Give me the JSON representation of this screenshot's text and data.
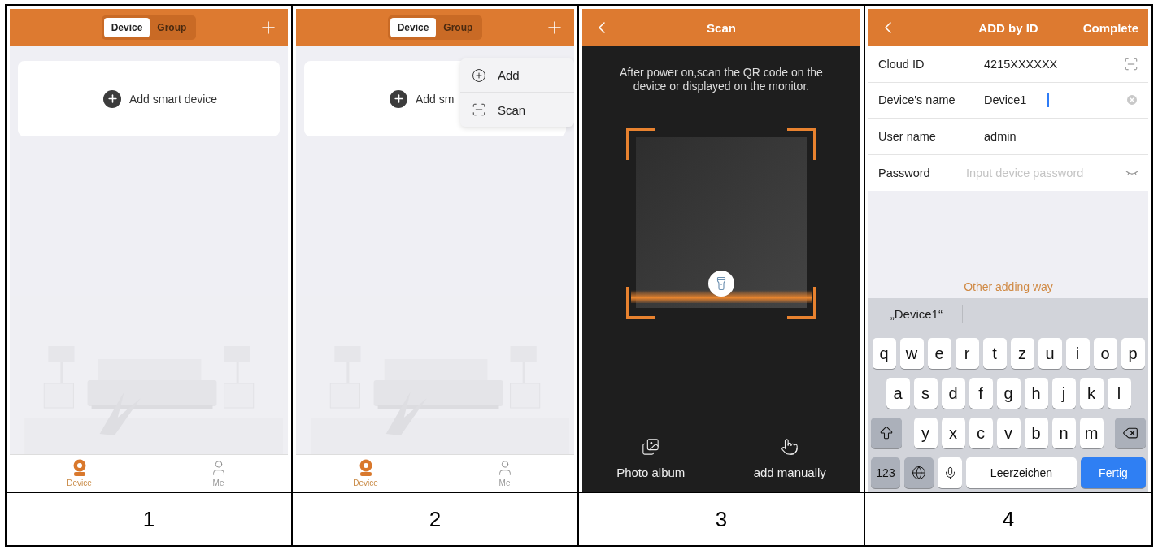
{
  "panels": [
    {
      "kind": "home",
      "caption": "1",
      "segments": [
        {
          "label": "Device",
          "selected": true
        },
        {
          "label": "Group",
          "selected": false
        }
      ],
      "add_card": "Add smart device",
      "background": {
        "kind": "picture"
      },
      "tabs": [
        {
          "label": "Device",
          "selected": true
        },
        {
          "label": "Me",
          "selected": false
        }
      ]
    },
    {
      "kind": "home",
      "caption": "2",
      "segments": [
        {
          "label": "Device",
          "selected": true
        },
        {
          "label": "Group",
          "selected": false
        }
      ],
      "add_card": "Add sm",
      "menu": [
        {
          "label": "Add"
        },
        {
          "label": "Scan"
        }
      ],
      "background": {
        "kind": "picture"
      },
      "tabs": [
        {
          "label": "Device",
          "selected": true
        },
        {
          "label": "Me",
          "selected": false
        }
      ]
    },
    {
      "kind": "scan",
      "caption": "3",
      "title": "Scan",
      "instruction": "After power on,scan the QR code on the device or displayed on the monitor.",
      "actions": [
        {
          "label": "Photo album"
        },
        {
          "label": "add manually"
        }
      ]
    },
    {
      "kind": "add_by_id",
      "caption": "4",
      "title": "ADD by ID",
      "action": "Complete",
      "fields": [
        {
          "label": "Cloud ID",
          "value": "4215XXXXXX"
        },
        {
          "label": "Device's name",
          "value": "Device1",
          "focused": true
        },
        {
          "label": "User name",
          "value": "admin"
        },
        {
          "label": "Password",
          "placeholder": "Input device password"
        }
      ],
      "link": "Other adding way",
      "keyboard": {
        "suggestion": "„Device1“",
        "rows": [
          [
            "q",
            "w",
            "e",
            "r",
            "t",
            "z",
            "u",
            "i",
            "o",
            "p"
          ],
          [
            "a",
            "s",
            "d",
            "f",
            "g",
            "h",
            "j",
            "k",
            "l"
          ],
          [
            "y",
            "x",
            "c",
            "v",
            "b",
            "n",
            "m"
          ]
        ],
        "numbers": "123",
        "space": "Leerzeichen",
        "done": "Fertig"
      }
    }
  ]
}
